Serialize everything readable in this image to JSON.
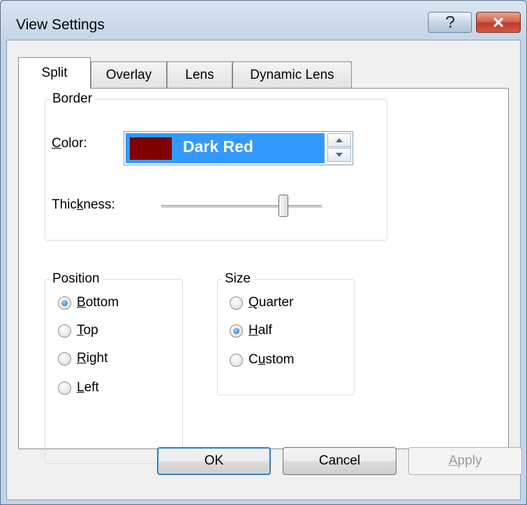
{
  "window": {
    "title": "View Settings"
  },
  "titlebar_buttons": {
    "help": "?",
    "close": "X"
  },
  "tabs": [
    {
      "label": "Split",
      "active": true
    },
    {
      "label": "Overlay",
      "active": false
    },
    {
      "label": "Lens",
      "active": false
    },
    {
      "label": "Dynamic Lens",
      "active": false
    }
  ],
  "border": {
    "legend": "Border",
    "color_label": "Color:",
    "color_value": "Dark Red",
    "swatch_color": "#800000",
    "thickness_label": "Thickness:",
    "thickness_fraction": 0.78
  },
  "position": {
    "legend": "Position",
    "options": [
      "Bottom",
      "Top",
      "Right",
      "Left"
    ],
    "selected": "Bottom"
  },
  "size": {
    "legend": "Size",
    "options": [
      "Quarter",
      "Half",
      "Custom"
    ],
    "selected": "Half"
  },
  "buttons": {
    "ok": "OK",
    "cancel": "Cancel",
    "apply": "Apply"
  },
  "colors": {
    "selection_highlight": "#3399ff",
    "close_button": "#c0392b"
  }
}
